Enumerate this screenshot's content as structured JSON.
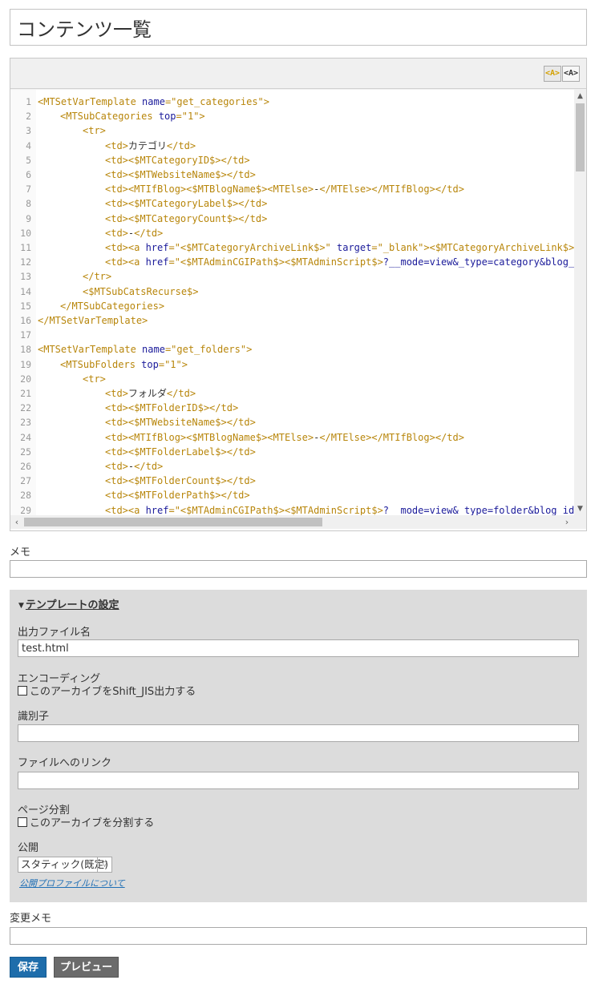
{
  "page": {
    "title_value": "コンテンツ一覧"
  },
  "editor": {
    "mode_buttons": [
      "<A>",
      "<A>"
    ],
    "lines": [
      {
        "n": "1",
        "indent": 0,
        "parts": [
          [
            "t",
            "<MTSetVarTemplate "
          ],
          [
            "a",
            "name"
          ],
          [
            "t",
            "=\"get_categories\">"
          ]
        ]
      },
      {
        "n": "2",
        "indent": 1,
        "parts": [
          [
            "t",
            "<MTSubCategories "
          ],
          [
            "a",
            "top"
          ],
          [
            "t",
            "=\"1\">"
          ]
        ]
      },
      {
        "n": "3",
        "indent": 2,
        "parts": [
          [
            "t",
            "<tr>"
          ]
        ]
      },
      {
        "n": "4",
        "indent": 3,
        "parts": [
          [
            "t",
            "<td>"
          ],
          [
            "x",
            "カテゴリ"
          ],
          [
            "t",
            "</td>"
          ]
        ]
      },
      {
        "n": "5",
        "indent": 3,
        "parts": [
          [
            "t",
            "<td><$MTCategoryID$></td>"
          ]
        ]
      },
      {
        "n": "6",
        "indent": 3,
        "parts": [
          [
            "t",
            "<td><$MTWebsiteName$></td>"
          ]
        ]
      },
      {
        "n": "7",
        "indent": 3,
        "parts": [
          [
            "t",
            "<td><MTIfBlog><$MTBlogName$><MTElse>"
          ],
          [
            "x",
            "-"
          ],
          [
            "t",
            "</MTElse></MTIfBlog></td>"
          ]
        ]
      },
      {
        "n": "8",
        "indent": 3,
        "parts": [
          [
            "t",
            "<td><$MTCategoryLabel$></td>"
          ]
        ]
      },
      {
        "n": "9",
        "indent": 3,
        "parts": [
          [
            "t",
            "<td><$MTCategoryCount$></td>"
          ]
        ]
      },
      {
        "n": "10",
        "indent": 3,
        "parts": [
          [
            "t",
            "<td>"
          ],
          [
            "x",
            "-"
          ],
          [
            "t",
            "</td>"
          ]
        ]
      },
      {
        "n": "11",
        "indent": 3,
        "parts": [
          [
            "t",
            "<td><a "
          ],
          [
            "a",
            "href"
          ],
          [
            "t",
            "=\"<$MTCategoryArchiveLink$>\" "
          ],
          [
            "a",
            "target"
          ],
          [
            "t",
            "=\"_blank\"><$MTCategoryArchiveLink$></a"
          ]
        ]
      },
      {
        "n": "12",
        "indent": 3,
        "parts": [
          [
            "t",
            "<td><a "
          ],
          [
            "a",
            "href"
          ],
          [
            "t",
            "=\"<$MTAdminCGIPath$><$MTAdminScript$>"
          ],
          [
            "a",
            "?__mode=view&_type=category&blog_id=<"
          ]
        ]
      },
      {
        "n": "13",
        "indent": 2,
        "parts": [
          [
            "t",
            "</tr>"
          ]
        ]
      },
      {
        "n": "14",
        "indent": 2,
        "parts": [
          [
            "t",
            "<$MTSubCatsRecurse$>"
          ]
        ]
      },
      {
        "n": "15",
        "indent": 1,
        "parts": [
          [
            "t",
            "</MTSubCategories>"
          ]
        ]
      },
      {
        "n": "16",
        "indent": 0,
        "parts": [
          [
            "t",
            "</MTSetVarTemplate>"
          ]
        ]
      },
      {
        "n": "17",
        "indent": 0,
        "parts": []
      },
      {
        "n": "18",
        "indent": 0,
        "parts": [
          [
            "t",
            "<MTSetVarTemplate "
          ],
          [
            "a",
            "name"
          ],
          [
            "t",
            "=\"get_folders\">"
          ]
        ]
      },
      {
        "n": "19",
        "indent": 1,
        "parts": [
          [
            "t",
            "<MTSubFolders "
          ],
          [
            "a",
            "top"
          ],
          [
            "t",
            "=\"1\">"
          ]
        ]
      },
      {
        "n": "20",
        "indent": 2,
        "parts": [
          [
            "t",
            "<tr>"
          ]
        ]
      },
      {
        "n": "21",
        "indent": 3,
        "parts": [
          [
            "t",
            "<td>"
          ],
          [
            "x",
            "フォルダ"
          ],
          [
            "t",
            "</td>"
          ]
        ]
      },
      {
        "n": "22",
        "indent": 3,
        "parts": [
          [
            "t",
            "<td><$MTFolderID$></td>"
          ]
        ]
      },
      {
        "n": "23",
        "indent": 3,
        "parts": [
          [
            "t",
            "<td><$MTWebsiteName$></td>"
          ]
        ]
      },
      {
        "n": "24",
        "indent": 3,
        "parts": [
          [
            "t",
            "<td><MTIfBlog><$MTBlogName$><MTElse>"
          ],
          [
            "x",
            "-"
          ],
          [
            "t",
            "</MTElse></MTIfBlog></td>"
          ]
        ]
      },
      {
        "n": "25",
        "indent": 3,
        "parts": [
          [
            "t",
            "<td><$MTFolderLabel$></td>"
          ]
        ]
      },
      {
        "n": "26",
        "indent": 3,
        "parts": [
          [
            "t",
            "<td>"
          ],
          [
            "x",
            "-"
          ],
          [
            "t",
            "</td>"
          ]
        ]
      },
      {
        "n": "27",
        "indent": 3,
        "parts": [
          [
            "t",
            "<td><$MTFolderCount$></td>"
          ]
        ]
      },
      {
        "n": "28",
        "indent": 3,
        "parts": [
          [
            "t",
            "<td><$MTFolderPath$></td>"
          ]
        ]
      },
      {
        "n": "29",
        "indent": 3,
        "parts": [
          [
            "t",
            "<td><a "
          ],
          [
            "a",
            "href"
          ],
          [
            "t",
            "=\"<$MTAdminCGIPath$><$MTAdminScript$>"
          ],
          [
            "a",
            "?__mode=view&_type=folder&blog_id=<$"
          ]
        ]
      }
    ]
  },
  "memo": {
    "label": "メモ",
    "value": ""
  },
  "settings": {
    "toggle_label": "テンプレートの設定",
    "output_file": {
      "label": "出力ファイル名",
      "value": "test.html"
    },
    "encoding": {
      "label": "エンコーディング",
      "checkbox_label": "このアーカイブをShift_JIS出力する",
      "checked": false
    },
    "identifier": {
      "label": "識別子",
      "value": ""
    },
    "file_link": {
      "label": "ファイルへのリンク",
      "value": ""
    },
    "paging": {
      "label": "ページ分割",
      "checkbox_label": "このアーカイブを分割する",
      "checked": false
    },
    "publish": {
      "label": "公開",
      "selected": "スタティック(既定)",
      "link": "公開プロファイルについて"
    }
  },
  "change_memo": {
    "label": "変更メモ",
    "value": ""
  },
  "actions": {
    "save_label": "保存",
    "preview_label": "プレビュー"
  },
  "colors": {
    "save_button": "#1e6dab",
    "preview_button": "#6b6b6b",
    "settings_bg": "#dcdcdc",
    "code_tag": "#b8860b",
    "code_attr": "#1a1a9a"
  }
}
